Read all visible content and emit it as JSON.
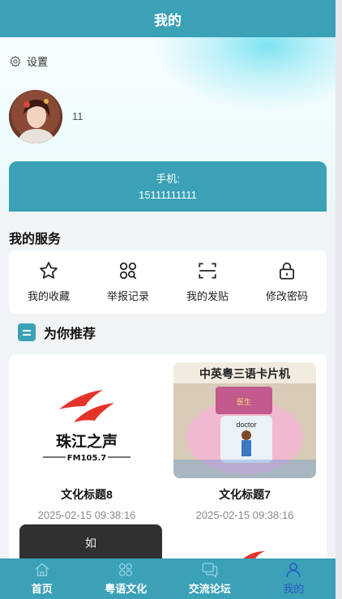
{
  "header": {
    "title": "我的"
  },
  "settings": {
    "label": "设置"
  },
  "profile": {
    "username": "11"
  },
  "phone": {
    "label": "手机:",
    "value": "15111111111"
  },
  "services": {
    "title": "我的服务",
    "items": [
      {
        "label": "我的收藏",
        "icon": "star-icon"
      },
      {
        "label": "举报记录",
        "icon": "grid-search-icon"
      },
      {
        "label": "我的发贴",
        "icon": "scan-icon"
      },
      {
        "label": "修改密码",
        "icon": "lock-icon"
      }
    ]
  },
  "recommend": {
    "title": "为你推荐",
    "cards": [
      {
        "title": "文化标题8",
        "date": "2025-02-15 09:38:16",
        "logo_text": "珠江之声",
        "logo_sub": "FM105.7"
      },
      {
        "title": "文化标题7",
        "date": "2025-02-15 09:38:16",
        "banner": "中英粤三语卡片机",
        "card_word": "doctor",
        "card_cn": "医生"
      }
    ],
    "partial_card_text": "如"
  },
  "nav": {
    "items": [
      {
        "label": "首页",
        "icon": "home-icon"
      },
      {
        "label": "粤语文化",
        "icon": "culture-icon"
      },
      {
        "label": "交流论坛",
        "icon": "chat-icon"
      },
      {
        "label": "我的",
        "icon": "user-icon"
      }
    ]
  },
  "colors": {
    "primary": "#3aa1b7",
    "active_nav": "#2c55c8"
  }
}
